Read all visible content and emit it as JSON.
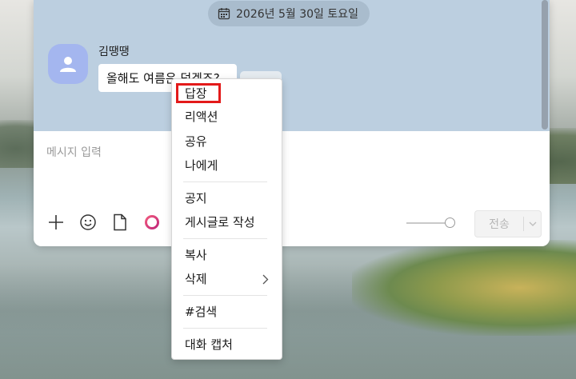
{
  "chat": {
    "date": "2026년 5월 30일 토요일",
    "sender": "김땡땡",
    "message": "올해도 여름은 덥겠죠?"
  },
  "input": {
    "placeholder": "메시지 입력",
    "send_label": "전송"
  },
  "toolbar_icons": [
    "plus-icon",
    "emoji-icon",
    "file-icon",
    "ring-icon"
  ],
  "context_menu": {
    "items": [
      "답장",
      "리액션",
      "공유",
      "나에게",
      "공지",
      "게시글로 작성",
      "복사",
      "삭제",
      "#검색",
      "대화 캡처"
    ],
    "highlighted": "답장"
  },
  "colors": {
    "chat_bg": "#bccfe0",
    "avatar": "#a4b6ef",
    "highlight": "#e31a1a",
    "ring_icon": "#e8327a"
  }
}
